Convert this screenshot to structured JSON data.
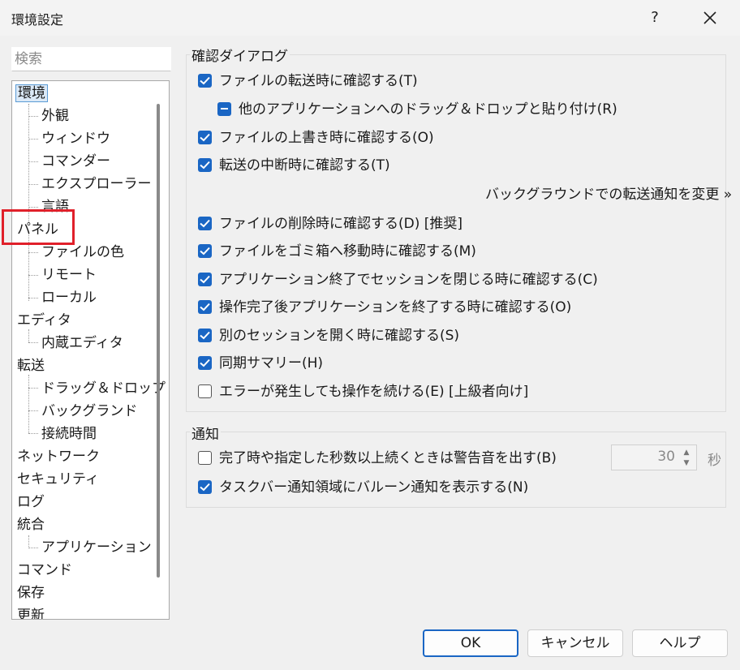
{
  "window": {
    "title": "環境設定",
    "help_symbol": "?"
  },
  "search": {
    "placeholder": "検索"
  },
  "tree": {
    "items": [
      {
        "label": "環境"
      },
      {
        "label": "外観"
      },
      {
        "label": "ウィンドウ"
      },
      {
        "label": "コマンダー"
      },
      {
        "label": "エクスプローラー"
      },
      {
        "label": "言語"
      },
      {
        "label": "パネル"
      },
      {
        "label": "ファイルの色"
      },
      {
        "label": "リモート"
      },
      {
        "label": "ローカル"
      },
      {
        "label": "エディタ"
      },
      {
        "label": "内蔵エディタ"
      },
      {
        "label": "転送"
      },
      {
        "label": "ドラッグ＆ドロップ"
      },
      {
        "label": "バックグランド"
      },
      {
        "label": "接続時間"
      },
      {
        "label": "ネットワーク"
      },
      {
        "label": "セキュリティ"
      },
      {
        "label": "ログ"
      },
      {
        "label": "統合"
      },
      {
        "label": "アプリケーション"
      },
      {
        "label": "コマンド"
      },
      {
        "label": "保存"
      },
      {
        "label": "更新"
      }
    ],
    "selected": "環境"
  },
  "confirm_group": {
    "title": "確認ダイアログ",
    "options": [
      {
        "label": "ファイルの転送時に確認する(T)",
        "state": "checked"
      },
      {
        "label": "他のアプリケーションへのドラッグ＆ドロップと貼り付け(R)",
        "state": "mixed"
      },
      {
        "label": "ファイルの上書き時に確認する(O)",
        "state": "checked"
      },
      {
        "label": "転送の中断時に確認する(T)",
        "state": "checked"
      },
      {
        "label": "ファイルの削除時に確認する(D) [推奨]",
        "state": "checked"
      },
      {
        "label": "ファイルをゴミ箱へ移動時に確認する(M)",
        "state": "checked"
      },
      {
        "label": "アプリケーション終了でセッションを閉じる時に確認する(C)",
        "state": "checked"
      },
      {
        "label": "操作完了後アプリケーションを終了する時に確認する(O)",
        "state": "checked"
      },
      {
        "label": "別のセッションを開く時に確認する(S)",
        "state": "checked"
      },
      {
        "label": "同期サマリー(H)",
        "state": "checked"
      },
      {
        "label": "エラーが発生しても操作を続ける(E) [上級者向け]",
        "state": "unchecked"
      }
    ],
    "background_link": "バックグラウンドでの転送通知を変更 »"
  },
  "notify_group": {
    "title": "通知",
    "options": [
      {
        "label": "完了時や指定した秒数以上続くときは警告音を出す(B)",
        "state": "unchecked"
      },
      {
        "label": "タスクバー通知領域にバルーン通知を表示する(N)",
        "state": "checked"
      }
    ],
    "seconds": "30",
    "seconds_unit": "秒"
  },
  "buttons": {
    "ok": "OK",
    "cancel": "キャンセル",
    "help": "ヘルプ"
  },
  "colors": {
    "accent": "#1a66c4",
    "highlight_box": "#e0202a"
  }
}
